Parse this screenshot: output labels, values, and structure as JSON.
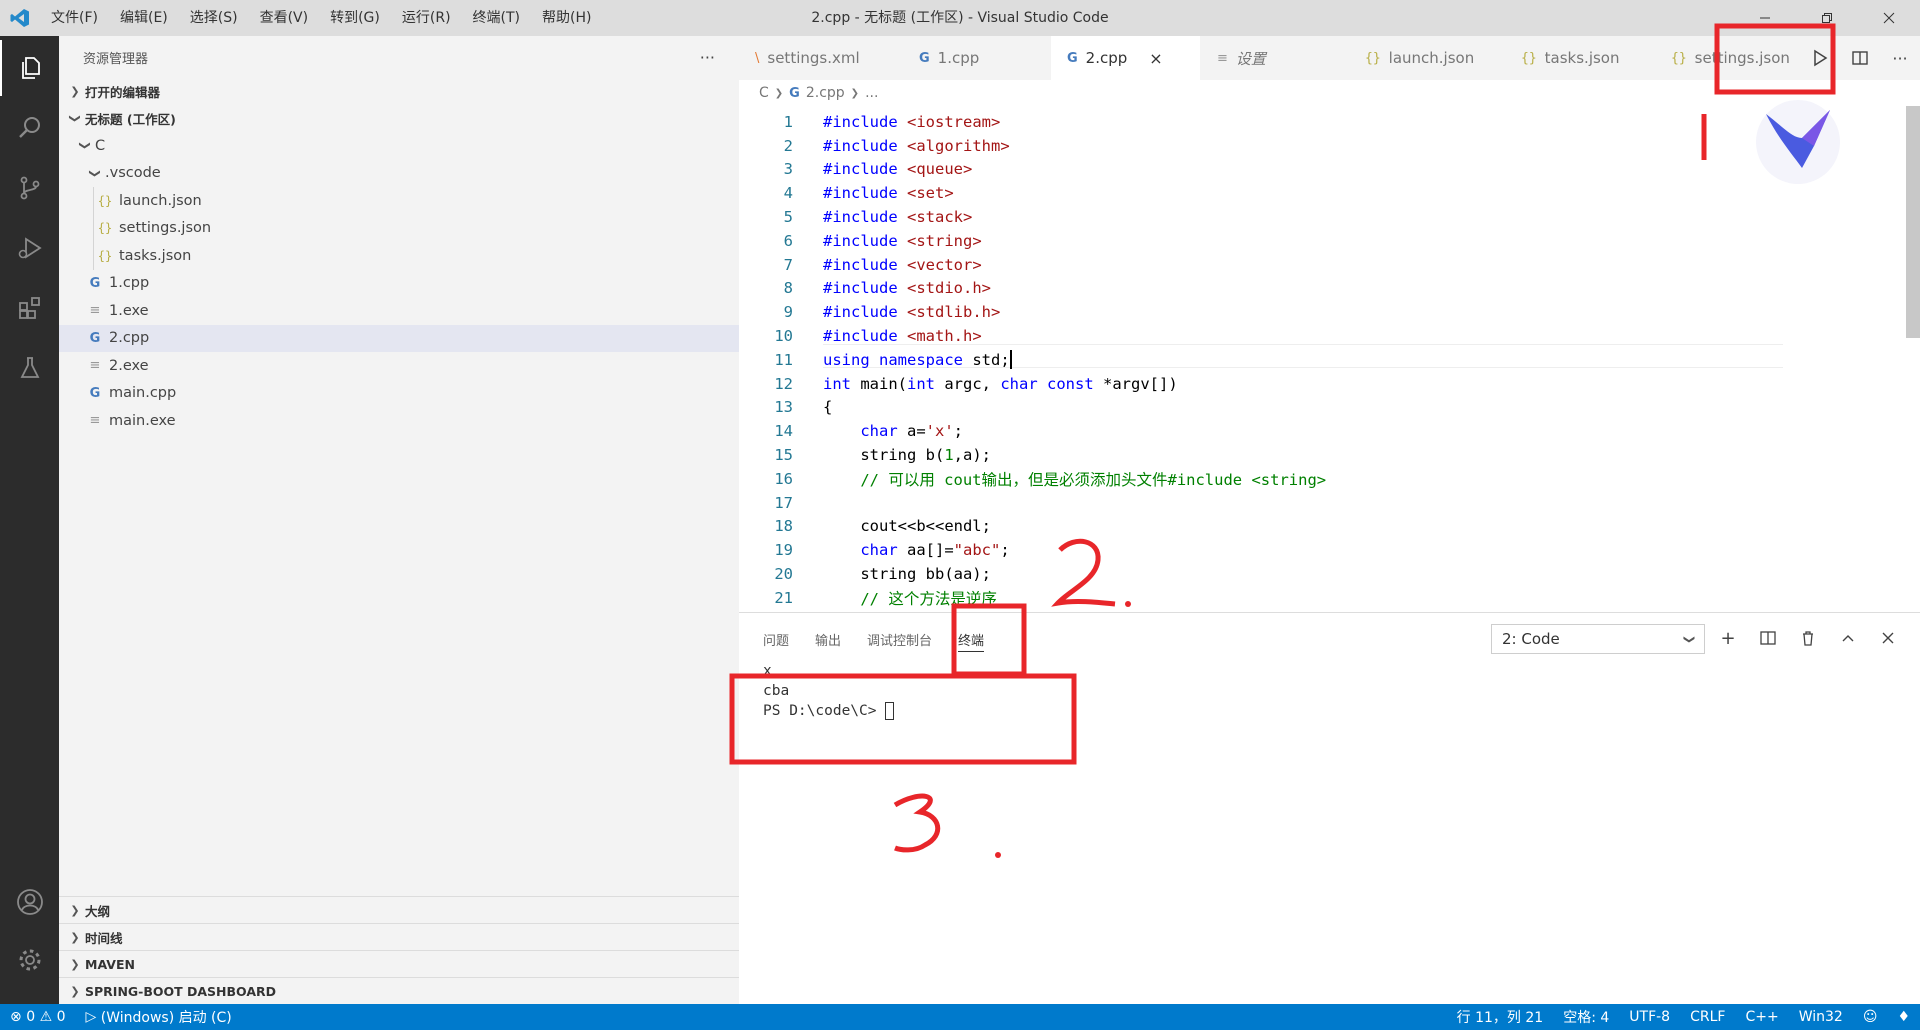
{
  "window": {
    "title": "2.cpp - 无标题 (工作区) - Visual Studio Code"
  },
  "menu": [
    "文件(F)",
    "编辑(E)",
    "选择(S)",
    "查看(V)",
    "转到(G)",
    "运行(R)",
    "终端(T)",
    "帮助(H)"
  ],
  "sidebar": {
    "header": "资源管理器",
    "more": "···",
    "sections": {
      "open_editors": "打开的编辑器",
      "workspace": "无标题 (工作区)"
    },
    "tree": [
      {
        "label": "C",
        "kind": "folder"
      },
      {
        "label": ".vscode",
        "kind": "folder"
      },
      {
        "label": "launch.json",
        "kind": "json"
      },
      {
        "label": "settings.json",
        "kind": "json"
      },
      {
        "label": "tasks.json",
        "kind": "json"
      },
      {
        "label": "1.cpp",
        "kind": "cpp"
      },
      {
        "label": "1.exe",
        "kind": "exe"
      },
      {
        "label": "2.cpp",
        "kind": "cpp",
        "selected": true
      },
      {
        "label": "2.exe",
        "kind": "exe"
      },
      {
        "label": "main.cpp",
        "kind": "cpp"
      },
      {
        "label": "main.exe",
        "kind": "exe"
      }
    ],
    "bottom_sections": [
      "大纲",
      "时间线",
      "MAVEN",
      "SPRING-BOOT DASHBOARD"
    ]
  },
  "tabs": [
    {
      "label": "settings.xml",
      "icon": "rss"
    },
    {
      "label": "1.cpp",
      "icon": "cpp"
    },
    {
      "label": "2.cpp",
      "icon": "cpp",
      "active": true,
      "close": "×"
    },
    {
      "label": "设置",
      "icon": "settings"
    },
    {
      "label": "launch.json",
      "icon": "json"
    },
    {
      "label": "tasks.json",
      "icon": "json"
    },
    {
      "label": "settings.json",
      "icon": "json"
    }
  ],
  "breadcrumb": [
    "C",
    "2.cpp",
    "..."
  ],
  "code": [
    [
      {
        "t": "#include ",
        "c": "pp"
      },
      {
        "t": "<iostream>",
        "c": "str"
      }
    ],
    [
      {
        "t": "#include ",
        "c": "pp"
      },
      {
        "t": "<algorithm>",
        "c": "str"
      }
    ],
    [
      {
        "t": "#include ",
        "c": "pp"
      },
      {
        "t": "<queue>",
        "c": "str"
      }
    ],
    [
      {
        "t": "#include ",
        "c": "pp"
      },
      {
        "t": "<set>",
        "c": "str"
      }
    ],
    [
      {
        "t": "#include ",
        "c": "pp"
      },
      {
        "t": "<stack>",
        "c": "str"
      }
    ],
    [
      {
        "t": "#include ",
        "c": "pp"
      },
      {
        "t": "<string>",
        "c": "str"
      }
    ],
    [
      {
        "t": "#include ",
        "c": "pp"
      },
      {
        "t": "<vector>",
        "c": "str"
      }
    ],
    [
      {
        "t": "#include ",
        "c": "pp"
      },
      {
        "t": "<stdio.h>",
        "c": "str"
      }
    ],
    [
      {
        "t": "#include ",
        "c": "pp"
      },
      {
        "t": "<stdlib.h>",
        "c": "str"
      }
    ],
    [
      {
        "t": "#include ",
        "c": "pp"
      },
      {
        "t": "<math.h>",
        "c": "str"
      }
    ],
    [
      {
        "t": "using ",
        "c": "kw"
      },
      {
        "t": "namespace ",
        "c": "kw"
      },
      {
        "t": "std;",
        "c": "plain"
      }
    ],
    [
      {
        "t": "int ",
        "c": "kw"
      },
      {
        "t": "main(",
        "c": "plain"
      },
      {
        "t": "int ",
        "c": "kw"
      },
      {
        "t": "argc, ",
        "c": "plain"
      },
      {
        "t": "char ",
        "c": "kw"
      },
      {
        "t": "const ",
        "c": "kw"
      },
      {
        "t": "*argv[])",
        "c": "plain"
      }
    ],
    [
      {
        "t": "{",
        "c": "plain"
      }
    ],
    [
      {
        "t": "    char ",
        "c": "kw"
      },
      {
        "t": "a=",
        "c": "plain"
      },
      {
        "t": "'x'",
        "c": "str"
      },
      {
        "t": ";",
        "c": "plain"
      }
    ],
    [
      {
        "t": "    string b(",
        "c": "plain"
      },
      {
        "t": "1",
        "c": "cmt"
      },
      {
        "t": ",a);",
        "c": "plain"
      }
    ],
    [
      {
        "t": "    // 可以用 cout输出，但是必须添加头文件#include <string>",
        "c": "cmt"
      }
    ],
    [],
    [
      {
        "t": "    cout<<b<<endl;",
        "c": "plain"
      }
    ],
    [
      {
        "t": "    char ",
        "c": "kw"
      },
      {
        "t": "aa[]=",
        "c": "plain"
      },
      {
        "t": "\"abc\"",
        "c": "str"
      },
      {
        "t": ";",
        "c": "plain"
      }
    ],
    [
      {
        "t": "    string bb(aa);",
        "c": "plain"
      }
    ],
    [
      {
        "t": "    // 这个方法是逆序",
        "c": "cmt"
      }
    ]
  ],
  "panel": {
    "tabs": [
      "问题",
      "输出",
      "调试控制台",
      "终端"
    ],
    "active_tab": "终端",
    "terminal_select": "2: Code",
    "terminal_lines": [
      "x",
      "cba",
      "PS D:\\code\\C> "
    ]
  },
  "status": {
    "errors": "0",
    "warnings": "0",
    "debug": "(Windows) 启动 (C)",
    "position": "行 11，列 21",
    "spaces": "空格: 4",
    "encoding": "UTF-8",
    "eol": "CRLF",
    "language": "C++",
    "platform": "Win32"
  },
  "annotations": {
    "mark1": "1",
    "mark2": "2.",
    "mark3": "3."
  },
  "colors": {
    "statusbar": "#007acc",
    "activitybar": "#2c2c2c",
    "annotation": "#e8262a"
  }
}
